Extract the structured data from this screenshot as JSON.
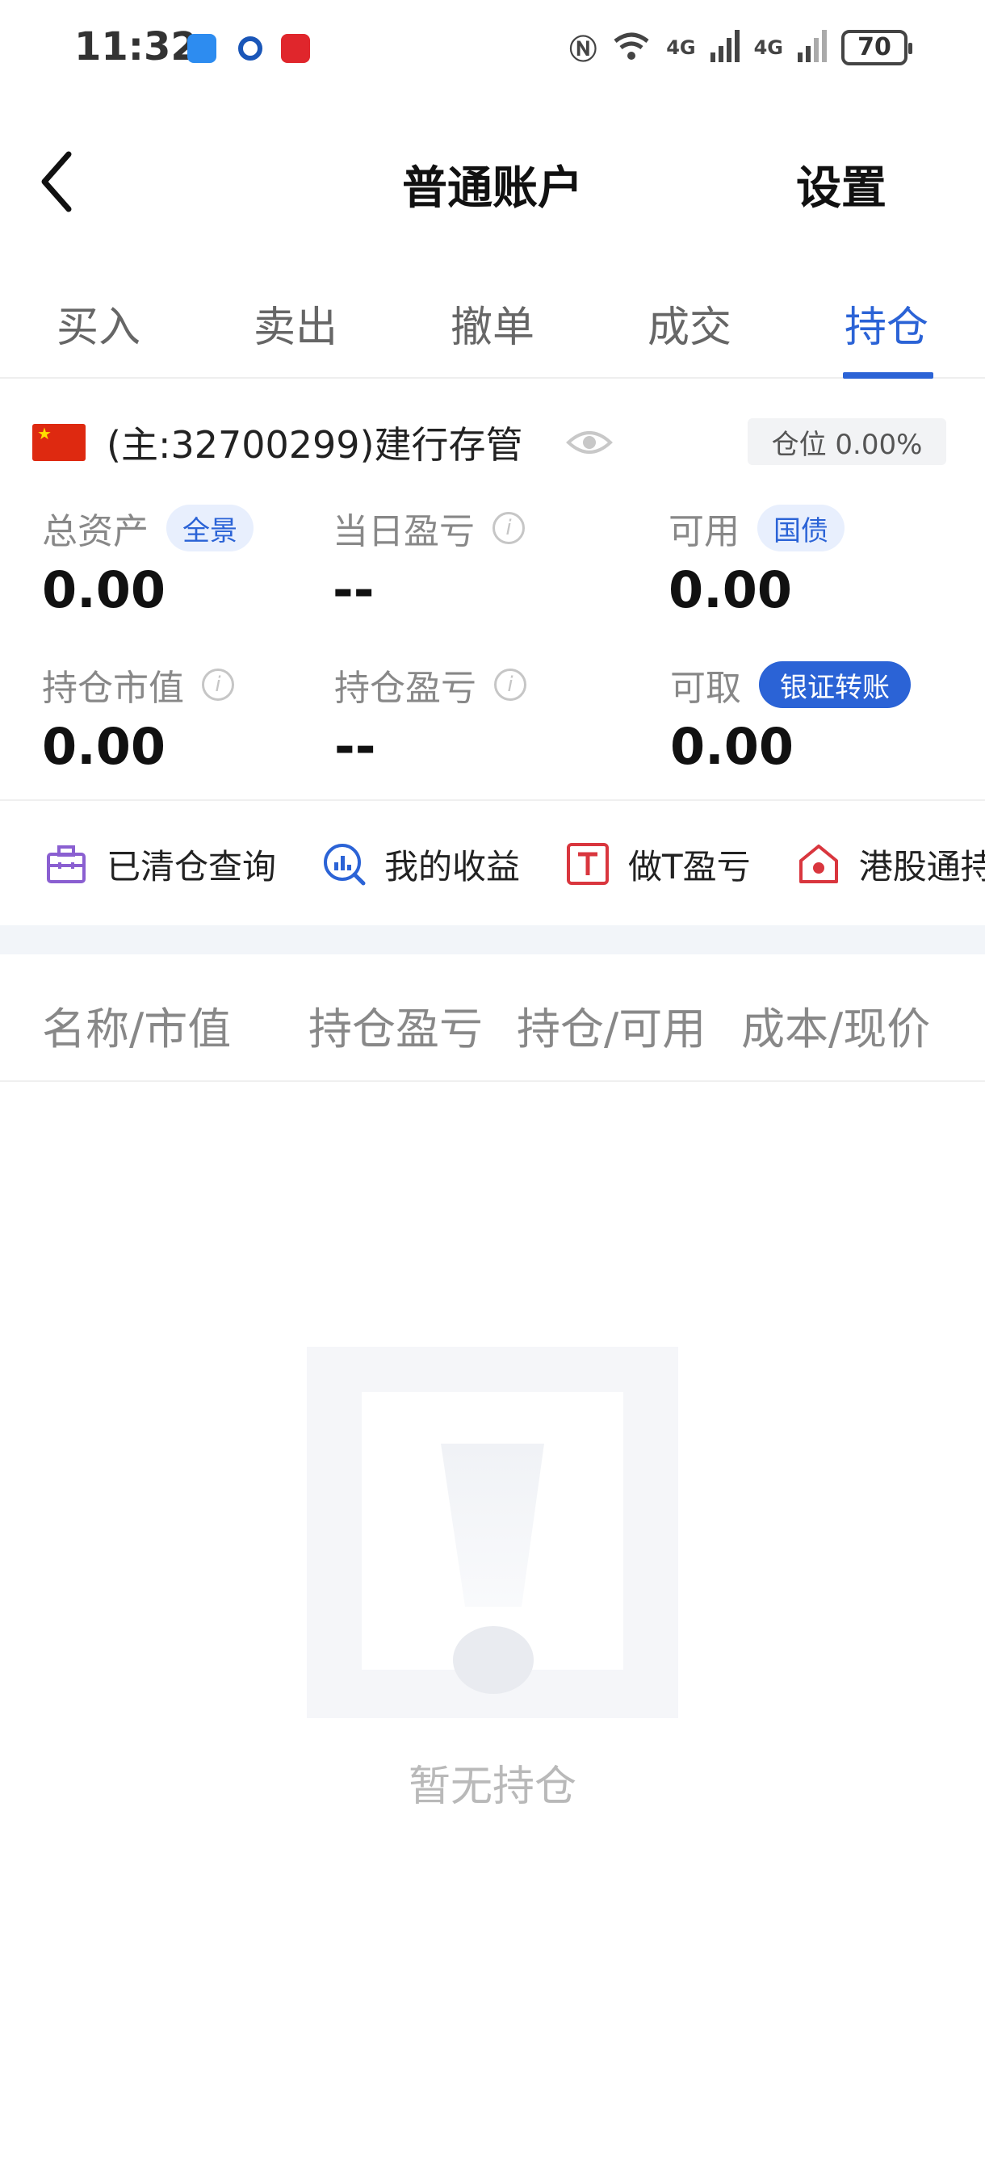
{
  "status_bar": {
    "time": "11:32",
    "network_1": "4G",
    "network_2": "4G",
    "battery": "70",
    "icons": [
      "message-app-icon",
      "c-app-icon",
      "red-app-icon",
      "nfc-icon",
      "wifi-icon",
      "signal-icon",
      "signal-icon",
      "battery-icon"
    ]
  },
  "header": {
    "title": "普通账户",
    "settings_label": "设置",
    "back_icon": "chevron-left-icon"
  },
  "tabs": [
    {
      "label": "买入",
      "active": false
    },
    {
      "label": "卖出",
      "active": false
    },
    {
      "label": "撤单",
      "active": false
    },
    {
      "label": "成交",
      "active": false
    },
    {
      "label": "持仓",
      "active": true
    }
  ],
  "account": {
    "name": "(主:32700299)建行存管",
    "position_ratio": "仓位 0.00%",
    "flag_icon": "china-flag-icon"
  },
  "assets": {
    "total_assets": {
      "label": "总资产",
      "badge": "全景",
      "value": "0.00"
    },
    "daily_pnl": {
      "label": "当日盈亏",
      "value": "--"
    },
    "available": {
      "label": "可用",
      "badge": "国债",
      "value": "0.00"
    },
    "market_value": {
      "label": "持仓市值",
      "value": "0.00"
    },
    "position_pnl": {
      "label": "持仓盈亏",
      "value": "--"
    },
    "withdrawable": {
      "label": "可取",
      "badge": "银证转账",
      "value": "0.00"
    }
  },
  "shortcuts": [
    {
      "label": "已清仓查询",
      "icon": "briefcase-icon"
    },
    {
      "label": "我的收益",
      "icon": "chart-search-icon"
    },
    {
      "label": "做T盈亏",
      "icon": "t-box-icon"
    },
    {
      "label": "港股通持",
      "icon": "hk-house-icon"
    }
  ],
  "table_headers": [
    "名称/市值",
    "持仓盈亏",
    "持仓/可用",
    "成本/现价"
  ],
  "empty_state": {
    "text": "暂无持仓",
    "icon": "exclamation-placeholder-icon"
  },
  "colors": {
    "accent": "#2b63d6",
    "muted_text": "#888888",
    "badge_bg": "#e8effd"
  }
}
